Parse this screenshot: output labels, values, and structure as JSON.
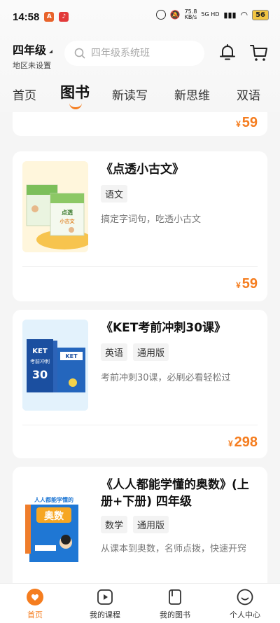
{
  "status_bar": {
    "time": "14:58",
    "network_speed": "75.8",
    "network_unit": "KB/s",
    "signal_label": "5G HD",
    "battery": "56"
  },
  "header": {
    "grade": "四年级",
    "region": "地区未设置",
    "search_placeholder": "四年级系统班"
  },
  "tabs": [
    {
      "label": "首页"
    },
    {
      "label": "图书"
    },
    {
      "label": "新读写"
    },
    {
      "label": "新思维"
    },
    {
      "label": "双语"
    }
  ],
  "colors": {
    "accent": "#f57d1f"
  },
  "books": [
    {
      "price_symbol": "¥",
      "price": "59"
    },
    {
      "title": "《点透小古文》",
      "tags": [
        "语文"
      ],
      "description": "搞定字词句，吃透小古文",
      "price_symbol": "¥",
      "price": "59",
      "cover_text": "点透小古文"
    },
    {
      "title": "《KET考前冲刺30课》",
      "tags": [
        "英语",
        "通用版"
      ],
      "description": "考前冲刺30课，必刷必看轻松过",
      "price_symbol": "¥",
      "price": "298",
      "cover_text": "KET考前冲刺30课"
    },
    {
      "title_line1": "《人人都能学懂的奥数》(上",
      "title_line2": "册+下册) 四年级",
      "tags": [
        "数学",
        "通用版"
      ],
      "description": "从课本到奥数，名师点拨，快速开窍",
      "cover_text": "人人都能学懂的奥数"
    }
  ],
  "bottom_nav": [
    {
      "label": "首页",
      "icon": "home-heart-icon"
    },
    {
      "label": "我的课程",
      "icon": "play-icon"
    },
    {
      "label": "我的图书",
      "icon": "book-icon"
    },
    {
      "label": "个人中心",
      "icon": "smile-icon"
    }
  ]
}
